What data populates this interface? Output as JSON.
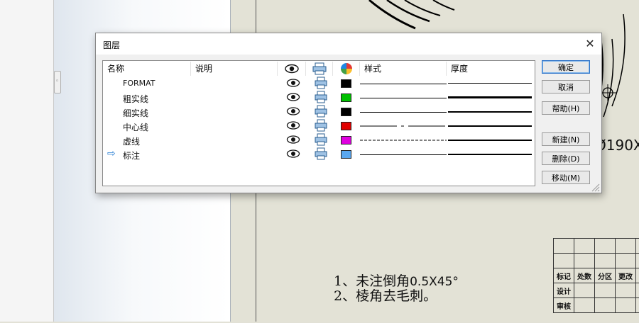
{
  "background": {
    "dimension_text": "Ø190X",
    "notes": [
      {
        "prefix": "1、未注倒角",
        "suffix": "0.5X45°"
      },
      {
        "prefix": "2、棱角去毛刺。",
        "suffix": ""
      }
    ],
    "title_block": {
      "headers": [
        "标记",
        "处数",
        "分区",
        "更改"
      ],
      "rows": [
        "设计",
        "审核"
      ]
    }
  },
  "dialog": {
    "title": "图层",
    "columns": {
      "name": "名称",
      "description": "说明",
      "visible": "eye-icon",
      "print": "printer-icon",
      "color": "color-wheel-icon",
      "style": "样式",
      "thickness": "厚度"
    },
    "layers": [
      {
        "name": "FORMAT",
        "color": "#000000",
        "style": "solid",
        "thickness": "thin",
        "current": false
      },
      {
        "name": "粗实线",
        "color": "#00c000",
        "style": "solid",
        "thickness": "thick",
        "current": false
      },
      {
        "name": "细实线",
        "color": "#000000",
        "style": "solid",
        "thickness": "thin",
        "current": false
      },
      {
        "name": "中心线",
        "color": "#e00000",
        "style": "center",
        "thickness": "thin",
        "current": false
      },
      {
        "name": "虚线",
        "color": "#e000e0",
        "style": "dashed",
        "thickness": "thin",
        "current": false
      },
      {
        "name": "标注",
        "color": "#5aa8f0",
        "style": "solid",
        "thickness": "thin",
        "current": true
      }
    ],
    "buttons": {
      "ok": "确定",
      "cancel": "取消",
      "help": "帮助(H)",
      "new": "新建(N)",
      "delete": "删除(D)",
      "move": "移动(M)"
    }
  }
}
